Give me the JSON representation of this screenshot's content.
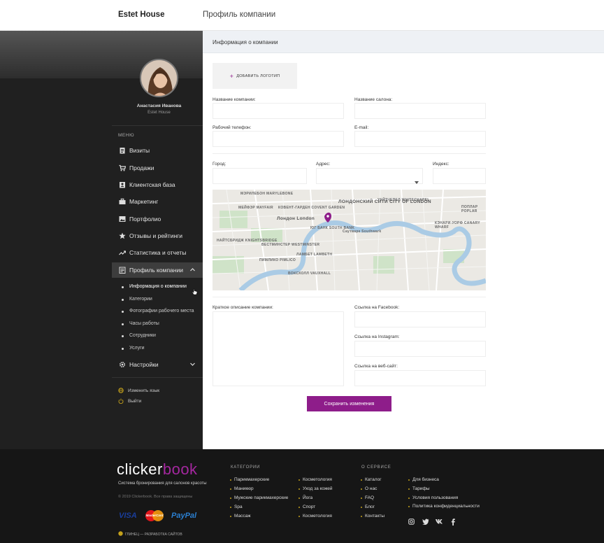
{
  "header": {
    "brand": "Estet House",
    "title": "Профиль компании"
  },
  "user": {
    "name": "Анастасия Иванова",
    "company": "Estet House"
  },
  "menu": {
    "heading": "МЕНЮ",
    "items": [
      {
        "label": "Визиты",
        "icon": "clipboard-icon"
      },
      {
        "label": "Продажи",
        "icon": "cart-icon"
      },
      {
        "label": "Клиентская база",
        "icon": "contacts-icon"
      },
      {
        "label": "Маркетинг",
        "icon": "briefcase-icon"
      },
      {
        "label": "Портфолио",
        "icon": "image-icon"
      },
      {
        "label": "Отзывы и рейтинги",
        "icon": "star-icon"
      },
      {
        "label": "Статистика и отчеты",
        "icon": "trending-icon"
      },
      {
        "label": "Профиль компании",
        "icon": "profile-icon"
      },
      {
        "label": "Настройки",
        "icon": "gear-icon"
      }
    ],
    "subitems": [
      "Информация о компании",
      "Категории",
      "Фотографии рабочего места",
      "Часы работы",
      "Сотрудники",
      "Услуги"
    ],
    "change_language": "Изменить язык",
    "logout": "Выйти"
  },
  "section": {
    "title": "Информация о компании"
  },
  "form": {
    "add_logo": "ДОБАВИТЬ ЛОГОТИП",
    "company_name_label": "Название компании:",
    "salon_name_label": "Название салона:",
    "work_phone_label": "Рабочий телефон:",
    "email_label": "E-mail:",
    "city_label": "Город:",
    "address_label": "Адрес:",
    "zip_label": "Индекс:",
    "description_label": "Краткое описание компании:",
    "facebook_label": "Ссылка на Facebook:",
    "instagram_label": "Ссылка на Instagram:",
    "website_label": "Ссылка на веб-сайт:",
    "save": "Сохранить изменения"
  },
  "map": {
    "labels": [
      "МЭРИЛЕБОН MARYLEBONE",
      "КОВЕНТ-ГАРДЕН COVENT GARDEN",
      "ЛОНДОНСКИЙ СИТИ CITY OF LONDON",
      "УАЙТЧЕПЕЛ WHITECHAPEL",
      "МЕЙФЭР MAYFAIR",
      "Лондон London",
      "ЮГ БАНК SOUTH BANK",
      "Саутварк Southwark",
      "НАЙТСБРИДЖ KNIGHTSBRIDGE",
      "ВЕСТМИНСТЕР WESTMINSTER",
      "ПИМЛИКО PIMLICO",
      "ЛАМБЕТ LAMBETH",
      "ВОКСХОЛЛ VAUXHALL",
      "ПОПЛАР POPLAR",
      "КЭНАРИ-УОРФ CANARY WHARF"
    ]
  },
  "footer": {
    "logo_a": "clicker",
    "logo_b": "book",
    "tagline": "Система бронирования для салонов красоты",
    "copyright": "© 2019 Clickerbook. Все права защищены",
    "categories_heading": "КАТЕГОРИИ",
    "about_heading": "О СЕРВИСЕ",
    "categories_col1": [
      "Парикмахерские",
      "Маникюр",
      "Мужские парикмахерские",
      "Spa",
      "Массаж"
    ],
    "categories_col2": [
      "Косметология",
      "Уход за кожей",
      "Йога",
      "Спорт",
      "Косметология"
    ],
    "about_col1": [
      "Каталог",
      "О нас",
      "FAQ",
      "Блог",
      "Контакты"
    ],
    "about_col2": [
      "Для бизнеса",
      "Тарифы",
      "Условия пользования",
      "Политика конфиденциальности"
    ],
    "payments": [
      "VISA",
      "MasterCard",
      "PayPal"
    ],
    "developer": "ГЛИНЕЦ — РАЗРАБОТКА САЙТОВ",
    "social": [
      "instagram-icon",
      "twitter-icon",
      "vk-icon",
      "facebook-icon"
    ]
  },
  "colors": {
    "accent": "#8e1d8a",
    "sidebar": "#202020",
    "footer": "#161616",
    "bullet": "#c4a11b"
  }
}
